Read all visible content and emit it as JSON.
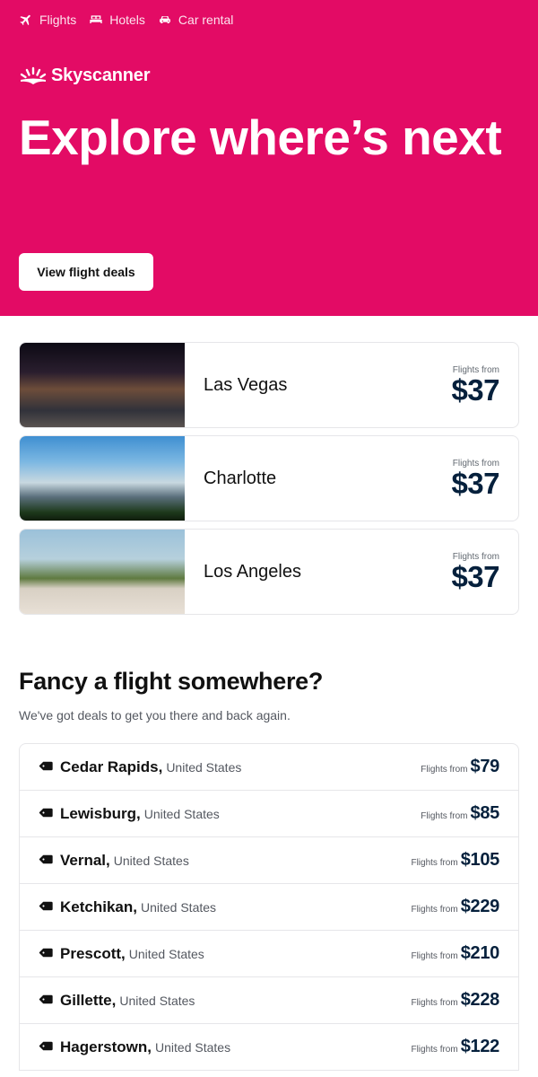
{
  "colors": {
    "brand": "#e30b65",
    "price": "#05203c",
    "text": "#111111",
    "muted": "#545860"
  },
  "nav": {
    "items": [
      {
        "label": "Flights",
        "icon": "plane-icon"
      },
      {
        "label": "Hotels",
        "icon": "bed-icon"
      },
      {
        "label": "Car rental",
        "icon": "car-icon"
      }
    ]
  },
  "brand": {
    "name": "Skyscanner",
    "icon": "sunrise-logo-icon"
  },
  "hero": {
    "title": "Explore where’s next",
    "cta_label": "View flight deals"
  },
  "destinations": [
    {
      "name": "Las Vegas",
      "from_label": "Flights from",
      "price": "$37",
      "image": "las-vegas-strip-photo"
    },
    {
      "name": "Charlotte",
      "from_label": "Flights from",
      "price": "$37",
      "image": "charlotte-skyline-photo"
    },
    {
      "name": "Los Angeles",
      "from_label": "Flights from",
      "price": "$37",
      "image": "los-angeles-beach-photo"
    }
  ],
  "deals_section": {
    "title": "Fancy a flight somewhere?",
    "subtitle": "We've got deals to get you there and back again.",
    "deals": [
      {
        "city": "Cedar Rapids,",
        "country": "United States",
        "from_label": "Flights from",
        "price": "$79"
      },
      {
        "city": "Lewisburg,",
        "country": "United States",
        "from_label": "Flights from",
        "price": "$85"
      },
      {
        "city": "Vernal,",
        "country": "United States",
        "from_label": "Flights from",
        "price": "$105"
      },
      {
        "city": "Ketchikan,",
        "country": "United States",
        "from_label": "Flights from",
        "price": "$229"
      },
      {
        "city": "Prescott,",
        "country": "United States",
        "from_label": "Flights from",
        "price": "$210"
      },
      {
        "city": "Gillette,",
        "country": "United States",
        "from_label": "Flights from",
        "price": "$228"
      },
      {
        "city": "Hagerstown,",
        "country": "United States",
        "from_label": "Flights from",
        "price": "$122"
      }
    ]
  }
}
